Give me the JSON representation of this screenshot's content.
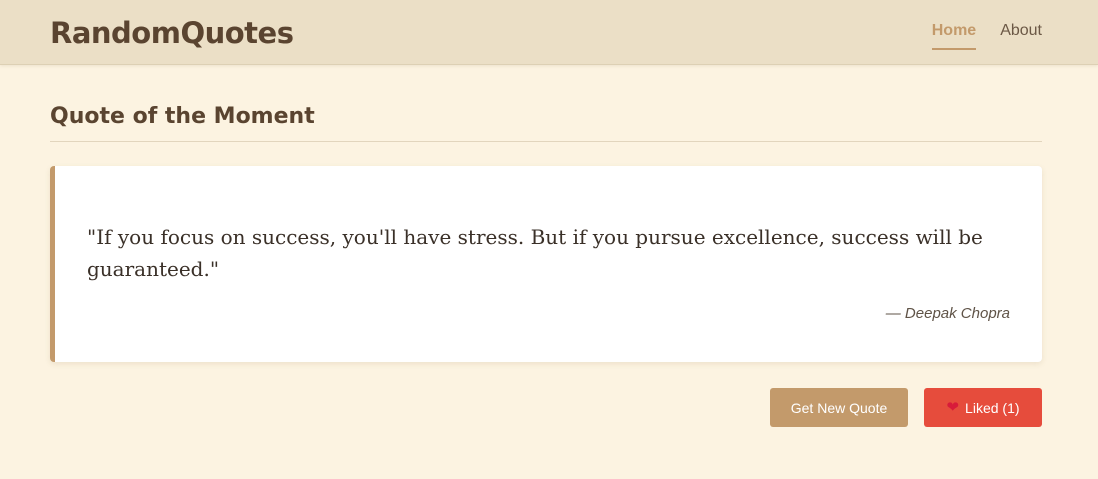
{
  "header": {
    "brand": "RandomQuotes",
    "nav": [
      {
        "label": "Home",
        "active": true
      },
      {
        "label": "About",
        "active": false
      }
    ]
  },
  "main": {
    "section_title": "Quote of the Moment",
    "quote": {
      "text": "\"If you focus on success, you'll have stress. But if you pursue excellence, success will be guaranteed.\"",
      "author": "— Deepak Chopra"
    },
    "actions": {
      "new_quote_label": "Get New Quote",
      "liked_label": "Liked (1)",
      "heart_icon": "heart-icon"
    }
  },
  "colors": {
    "accent": "#c39a6b",
    "like": "#e64c3c",
    "header_bg": "#ebdfc6",
    "page_bg": "#fcf3e1"
  }
}
